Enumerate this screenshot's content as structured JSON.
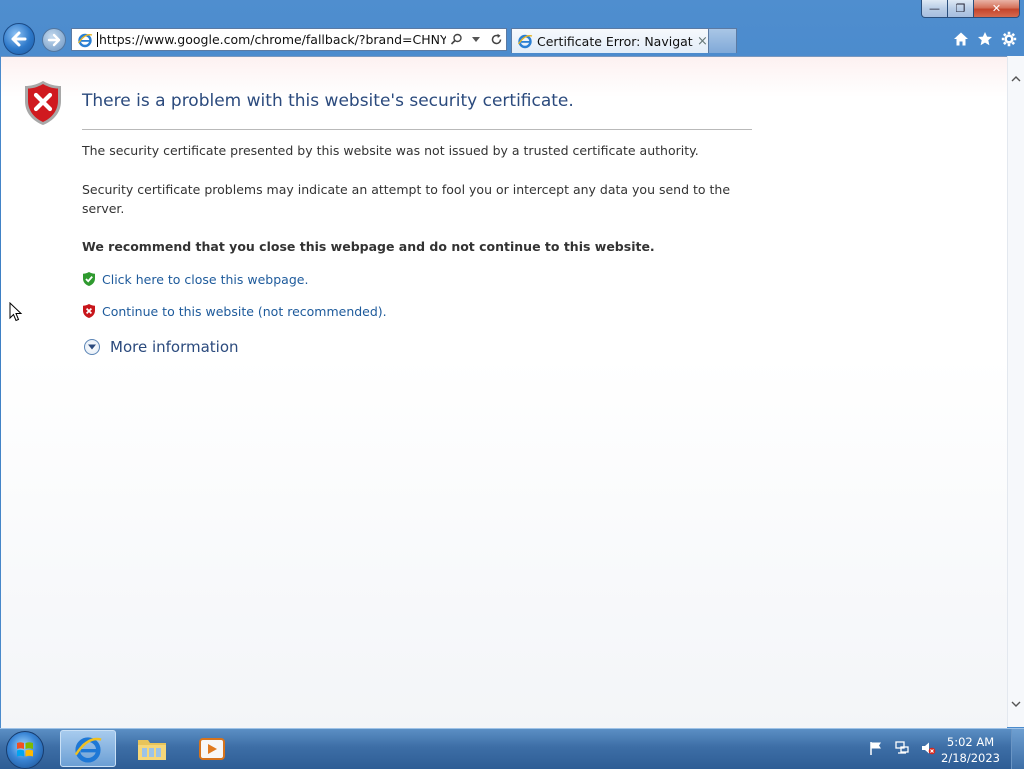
{
  "window": {
    "caption_buttons": {
      "minimize": "—",
      "maximize": "❐",
      "close": "✕"
    }
  },
  "nav": {
    "url": "https://www.google.com/chrome/fallback/?brand=CHNY&utm_ca",
    "tab_title": "Certificate Error: Navigation...",
    "tab_close": "×"
  },
  "page": {
    "title": "There is a problem with this website's security certificate.",
    "p1": "The security certificate presented by this website was not issued by a trusted certificate authority.",
    "p2": "Security certificate problems may indicate an attempt to fool you or intercept any data you send to the server.",
    "p3": "We recommend that you close this webpage and do not continue to this website.",
    "link_close": "Click here to close this webpage.",
    "link_continue": "Continue to this website (not recommended).",
    "more_info": "More information"
  },
  "taskbar": {
    "time": "5:02 AM",
    "date": "2/18/2023"
  },
  "icons": [
    "back-arrow-icon",
    "forward-arrow-icon",
    "ie-icon",
    "search-icon",
    "dropdown-icon",
    "refresh-icon",
    "home-icon",
    "favorites-star-icon",
    "gear-icon",
    "shield-error-icon",
    "shield-ok-icon",
    "chevron-down-icon",
    "windows-logo-icon",
    "folder-icon",
    "media-player-icon",
    "flag-icon",
    "network-icon",
    "volume-muted-icon"
  ],
  "colors": {
    "title": "#2b4a7d",
    "link": "#1d5a9b",
    "error_red": "#c8161b",
    "ok_green": "#2f9a2f"
  }
}
